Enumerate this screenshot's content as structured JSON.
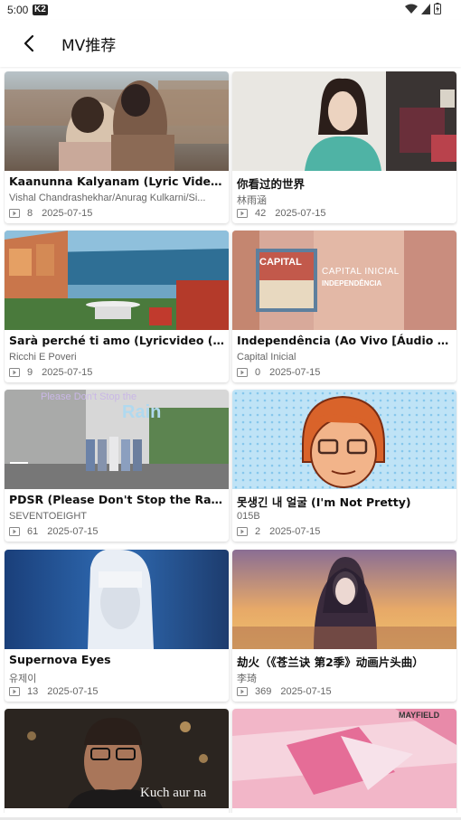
{
  "status": {
    "time": "5:00",
    "badge": "K2"
  },
  "header": {
    "title": "MV推荐"
  },
  "cards": [
    {
      "title": "Kaanunna Kalyanam (Lyric Video (Ve...",
      "artist": "Vishal Chandrashekhar/Anurag Kulkarni/Si...",
      "plays": "8",
      "date": "2025-07-15"
    },
    {
      "title": "你看过的世界",
      "artist": "林雨涵",
      "plays": "42",
      "date": "2025-07-15"
    },
    {
      "title": "Sarà perché ti amo (Lyricvideo (Magy...",
      "artist": "Ricchi E Poveri",
      "plays": "9",
      "date": "2025-07-15"
    },
    {
      "title": "Independência (Ao Vivo [Áudio Oficia...",
      "artist": "Capital Inicial",
      "plays": "0",
      "date": "2025-07-15",
      "thumb_text": {
        "line1": "CAPITAL INICIAL",
        "line2": "INDEPENDÊNCIA"
      }
    },
    {
      "title": "PDSR (Please Don't Stop the Rain) (T...",
      "artist": "SEVENTOEIGHT",
      "plays": "61",
      "date": "2025-07-15",
      "thumb_text": {
        "line1": "Please Don't Stop the",
        "line2": "Rain"
      }
    },
    {
      "title": "못생긴 내 얼굴 (I'm Not Pretty)",
      "artist": "015B",
      "plays": "2",
      "date": "2025-07-15"
    },
    {
      "title": "Supernova Eyes",
      "artist": "유제이",
      "plays": "13",
      "date": "2025-07-15"
    },
    {
      "title": "劫火（《苍兰诀 第2季》动画片头曲）",
      "artist": "李琦",
      "plays": "369",
      "date": "2025-07-15"
    },
    {
      "title": "",
      "artist": "",
      "plays": "",
      "date": "",
      "thumb_text": {
        "line1": "Kuch aur na"
      }
    },
    {
      "title": "",
      "artist": "",
      "plays": "",
      "date": "",
      "thumb_text": {
        "line1": "MAYFIELD"
      }
    }
  ]
}
